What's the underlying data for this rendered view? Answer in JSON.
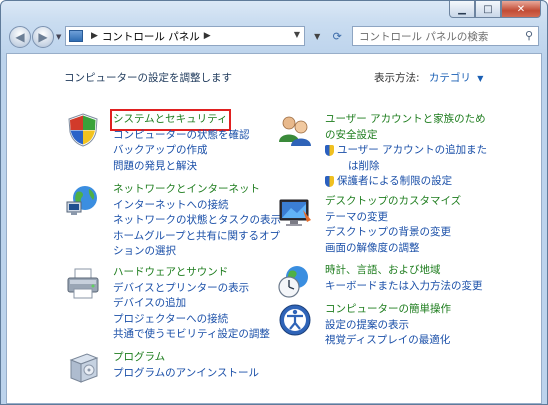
{
  "navigation": {
    "address_crumb": "コントロール パネル",
    "search_placeholder": "コントロール パネルの検索"
  },
  "header": {
    "heading": "コンピューターの設定を調整します",
    "view_by_label": "表示方法:",
    "view_by_value": "カテゴリ"
  },
  "categories_left": [
    {
      "title": "システムとセキュリティ",
      "links": [
        "コンピューターの状態を確認",
        "バックアップの作成",
        "問題の発見と解決"
      ]
    },
    {
      "title": "ネットワークとインターネット",
      "links": [
        "インターネットへの接続",
        "ネットワークの状態とタスクの表示",
        "ホームグループと共有に関するオプ",
        "ションの選択"
      ]
    },
    {
      "title": "ハードウェアとサウンド",
      "links": [
        "デバイスとプリンターの表示",
        "デバイスの追加",
        "プロジェクターへの接続",
        "共通で使うモビリティ設定の調整"
      ]
    },
    {
      "title": "プログラム",
      "links": [
        "プログラムのアンインストール"
      ]
    }
  ],
  "categories_right": [
    {
      "title_lines": [
        "ユーザー アカウントと家族のため",
        "の安全設定"
      ],
      "links": [
        "ユーザー アカウントの追加また",
        "は削除",
        "保護者による制限の設定"
      ]
    },
    {
      "title": "デスクトップのカスタマイズ",
      "links": [
        "テーマの変更",
        "デスクトップの背景の変更",
        "画面の解像度の調整"
      ]
    },
    {
      "title": "時計、言語、および地域",
      "links": [
        "キーボードまたは入力方法の変更"
      ]
    },
    {
      "title": "コンピューターの簡単操作",
      "links": [
        "設定の提案の表示",
        "視覚ディスプレイの最適化"
      ]
    }
  ],
  "colors": {
    "category_title": "#1e7d1e",
    "link": "#1a4fa8",
    "highlight_box": "#e02020"
  }
}
